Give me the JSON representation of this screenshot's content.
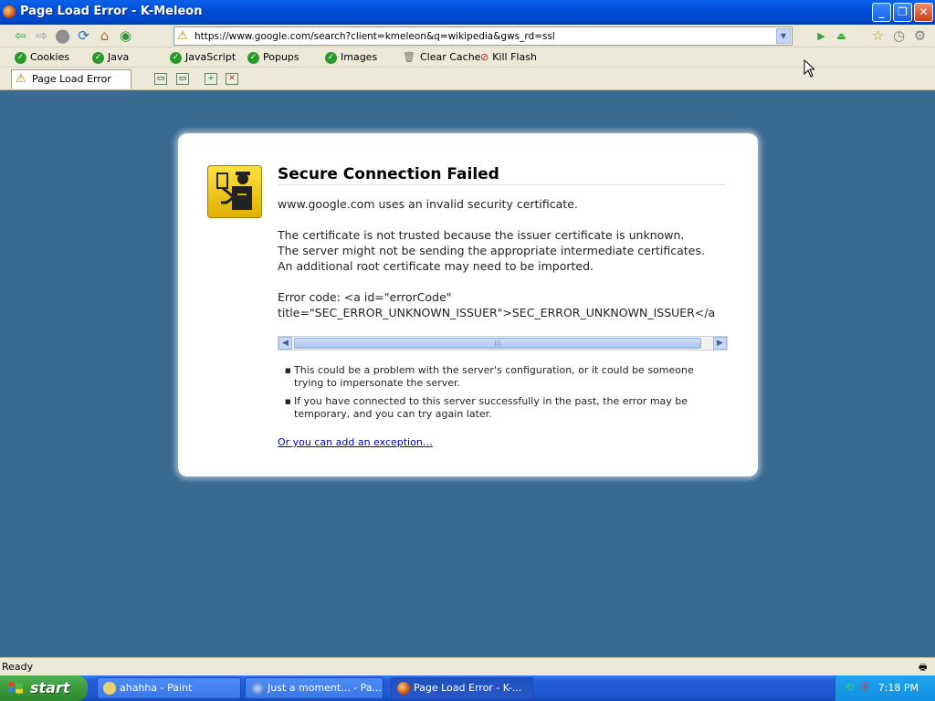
{
  "window": {
    "title": "Page Load Error - K-Meleon"
  },
  "nav": {
    "url": "https://www.google.com/search?client=kmeleon&q=wikipedia&gws_rd=ssl",
    "icons": [
      "back-icon",
      "forward-icon",
      "stop-icon",
      "reload-icon",
      "home-icon",
      "go-icon"
    ]
  },
  "plugins": {
    "items": [
      {
        "label": "Cookies"
      },
      {
        "label": "Java"
      },
      {
        "label": "JavaScript"
      },
      {
        "label": "Popups"
      },
      {
        "label": "Images"
      }
    ],
    "clear_cache": "Clear Cache",
    "kill_flash": "Kill Flash"
  },
  "tabs": {
    "active_label": "Page Load Error"
  },
  "error": {
    "title": "Secure Connection Failed",
    "line1": "www.google.com uses an invalid security certificate.",
    "para1": "The certificate is not trusted because the issuer certificate is unknown.",
    "para2": "The server might not be sending the appropriate intermediate certificates.",
    "para3": "An additional root certificate may need to be imported.",
    "code1": "Error code: <a id=\"errorCode\"",
    "code2": "title=\"SEC_ERROR_UNKNOWN_ISSUER\">SEC_ERROR_UNKNOWN_ISSUER</a",
    "bullet1": "This could be a problem with the server's configuration, or it could be someone trying to impersonate the server.",
    "bullet2": "If you have connected to this server successfully in the past, the error may be temporary, and you can try again later.",
    "exception_link": "Or you can add an exception…"
  },
  "status": {
    "text": "Ready"
  },
  "taskbar": {
    "start": "start",
    "tasks": [
      {
        "label": "ahahha - Paint"
      },
      {
        "label": "Just a moment... - Pa..."
      },
      {
        "label": "Page Load Error - K-..."
      }
    ],
    "clock": "7:18 PM"
  }
}
